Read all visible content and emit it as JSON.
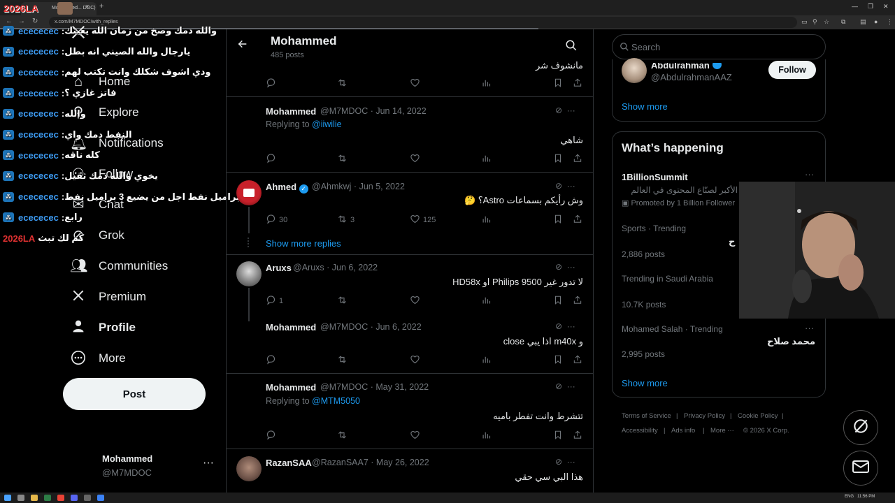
{
  "browser": {
    "tab_title": "Mohammed... DOC)",
    "new_tab": "+",
    "tab_close": "×",
    "url": "x.com/M7MDOC/with_replies",
    "window_controls": [
      "—",
      "❐",
      "✕"
    ]
  },
  "stream": {
    "logo": "2026LA",
    "logo_bottom": "2026LA",
    "chat": [
      {
        "user": "ecececec",
        "message": "والله دمك وصخ من زمان الله يعينك"
      },
      {
        "user": "ecececec",
        "message": "يارجال والله الصيني انه بطل"
      },
      {
        "user": "ecececec",
        "message": "ودي اشوف شكلك وانت تكتب لهم"
      },
      {
        "user": "ecececec",
        "message": "فاتز غازي ؟"
      },
      {
        "user": "ecececec",
        "message": "والله"
      },
      {
        "user": "ecececec",
        "message": "النفط دمك واي"
      },
      {
        "user": "ecececec",
        "message": "كله ناقه"
      },
      {
        "user": "ecececec",
        "message": "يخوي والله دمك ثقيل"
      },
      {
        "user": "ecececec",
        "message": "براميل نفط اجل من يضيع 3 براميل نفط"
      },
      {
        "user": "ecececec",
        "message": "رابع"
      }
    ],
    "chat_last": "كم لك تبث"
  },
  "nav": {
    "items": [
      {
        "label": "Home",
        "icon": "home-icon"
      },
      {
        "label": "Explore",
        "icon": "search-icon"
      },
      {
        "label": "Notifications",
        "icon": "bell-icon"
      },
      {
        "label": "Follow",
        "icon": "person-add-icon"
      },
      {
        "label": "Chat",
        "icon": "mail-icon"
      },
      {
        "label": "Grok",
        "icon": "grok-icon"
      },
      {
        "label": "Communities",
        "icon": "people-icon"
      },
      {
        "label": "Premium",
        "icon": "x-logo-icon"
      },
      {
        "label": "Profile",
        "icon": "person-icon"
      },
      {
        "label": "More",
        "icon": "more-circle-icon"
      }
    ],
    "post_label": "Post",
    "account_name": "Mohammed",
    "account_handle": "@M7MDOC",
    "account_more": "···"
  },
  "header": {
    "title": "Mohammed",
    "subtitle": "485 posts"
  },
  "timeline": {
    "top_partial_text": "مانشوف شر",
    "show_more_replies": "Show more replies",
    "tweets": [
      {
        "name": "Mohammed",
        "handle": "@M7MDOC",
        "date": "Jun 14, 2022",
        "replying_prefix": "Replying to ",
        "replying_to": "@iiwilie",
        "text": "شاهي"
      },
      {
        "name": "Ahmed",
        "handle": "@Ahmkwj",
        "date": "Jun 5, 2022",
        "text": "وش رأيكم بسماعات Astro؟ 🤔",
        "replies": "30",
        "reposts": "3",
        "likes": "125"
      },
      {
        "name": "Aruxs",
        "handle": "@Aruxs",
        "date": "Jun 6, 2022",
        "text": "لا تدور غير Philips 9500 او HD58x",
        "replies": "1"
      },
      {
        "name": "Mohammed",
        "handle": "@M7MDOC",
        "date": "Jun 6, 2022",
        "text": "و m40x اذا يبي close"
      },
      {
        "name": "Mohammed",
        "handle": "@M7MDOC",
        "date": "May 31, 2022",
        "replying_prefix": "Replying to ",
        "replying_to": "@MTM5050",
        "text": "تتشرط وانت تفطر باميه"
      },
      {
        "name": "RazanSAA",
        "handle": "@RazanSAA7",
        "date": "May 26, 2022",
        "text": "هذا البي سي حقي"
      }
    ]
  },
  "right": {
    "search_placeholder": "Search",
    "who_to_follow": {
      "name": "Abdulrahman",
      "handle": "@AbdulrahmanAAZ",
      "follow_label": "Follow",
      "show_more": "Show more"
    },
    "trends": {
      "heading": "What’s happening",
      "items": [
        {
          "title": "1BillionSummit",
          "desc": "الأكبر لصنّاع المحتوى في العالم",
          "promoted": "Promoted by 1 Billion Follower"
        },
        {
          "context": "Sports · Trending",
          "title": "ح",
          "posts": "2,886 posts"
        },
        {
          "context": "Trending in Saudi Arabia",
          "posts": "10.7K posts"
        },
        {
          "context": "Mohamed Salah · Trending",
          "title": "محمد صلاح",
          "posts": "2,995 posts"
        }
      ],
      "show_more": "Show more"
    },
    "footer": [
      "Terms of Service",
      "Privacy Policy",
      "Cookie Policy",
      "Accessibility",
      "Ads info",
      "More ···",
      "© 2026 X Corp."
    ]
  },
  "taskbar": {
    "lang": "ENG",
    "time": "11:56 PM"
  }
}
